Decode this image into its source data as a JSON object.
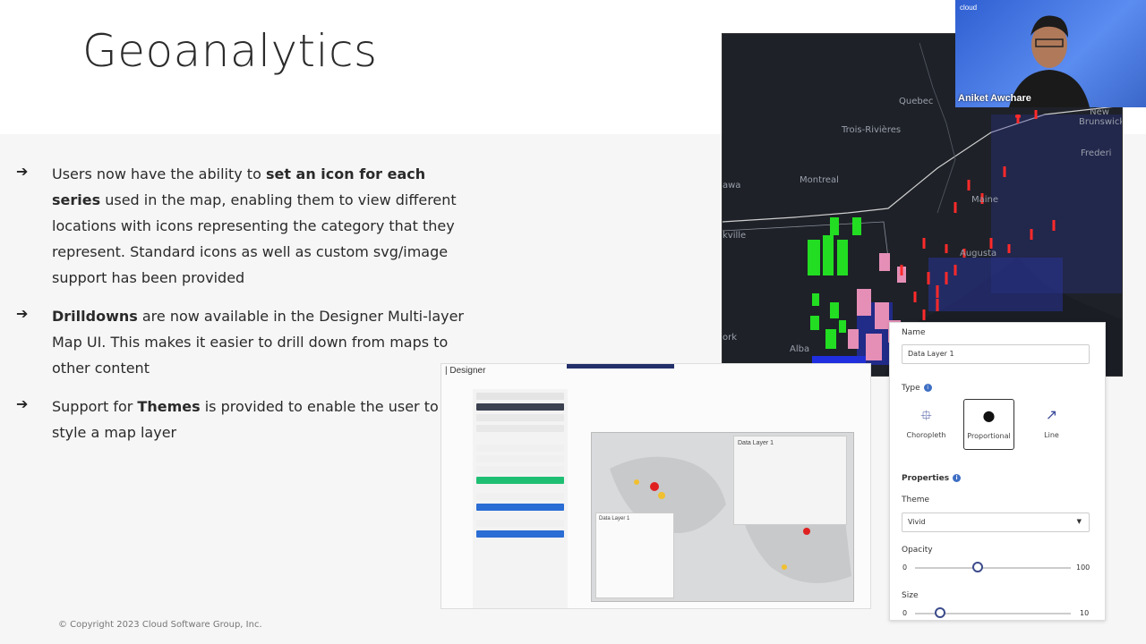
{
  "slide": {
    "title": "Geoanalytics",
    "bullets": [
      {
        "pre": "Users now have the ability to ",
        "bold": "set an icon for each series",
        "post": " used in the map, enabling them to view different locations with icons representing the category that they represent. Standard icons as well as custom svg/image support has been provided"
      },
      {
        "pre": "",
        "bold": "Drilldowns",
        "post": " are now available in the Designer Multi-layer Map UI. This makes it easier to drill down from maps to other content"
      },
      {
        "pre": "Support for ",
        "bold": "Themes",
        "post": " is provided to enable the user to style a map layer"
      }
    ],
    "arrow": "➔",
    "copyright": "© Copyright 2023 Cloud Software Group, Inc."
  },
  "map": {
    "places": [
      "Quebec",
      "Trois-Rivières",
      "Montreal",
      "awa",
      "kville",
      "Maine",
      "Augusta",
      "New Brunswick",
      "Frederi",
      "ork",
      "Alba"
    ]
  },
  "video": {
    "name": "Aniket Awchare",
    "logo": "cloud"
  },
  "designer": {
    "app_title": "Designer",
    "popup_title": "Data Layer 1",
    "legend_title": "Data Layer 1"
  },
  "panel": {
    "name_label": "Name",
    "name_value": "Data Layer 1",
    "type_label": "Type",
    "types": [
      {
        "label": "Choropleth",
        "icon": "choropleth-icon"
      },
      {
        "label": "Proportional",
        "icon": "proportional-icon",
        "selected": true
      },
      {
        "label": "Line",
        "icon": "line-icon"
      }
    ],
    "properties_label": "Properties",
    "theme_label": "Theme",
    "theme_value": "Vivid",
    "opacity_label": "Opacity",
    "opacity_min": "0",
    "opacity_max": "100",
    "opacity_value": 40,
    "size_label": "Size",
    "size_min": "0",
    "size_max": "10",
    "size_value": 1.6
  }
}
